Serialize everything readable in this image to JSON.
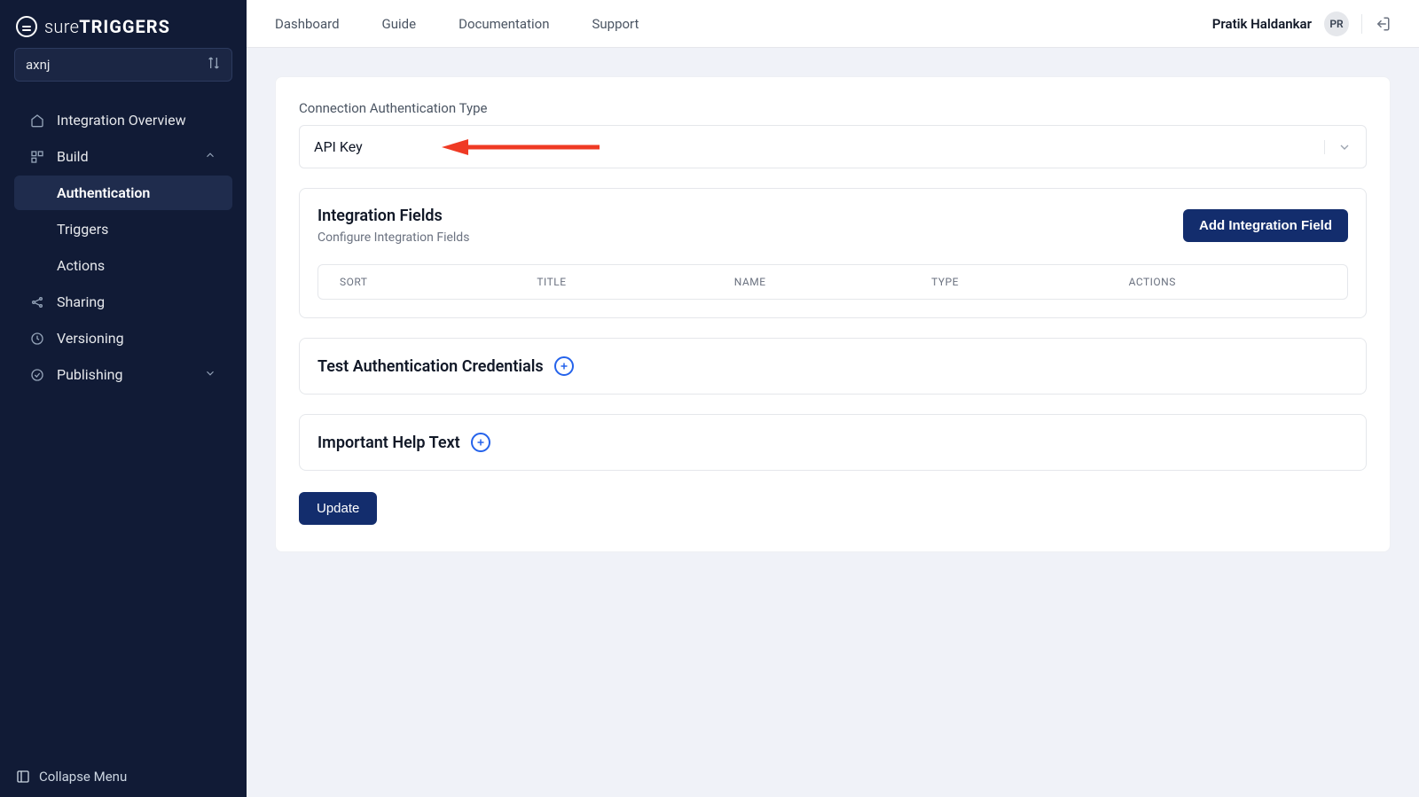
{
  "brand": {
    "name_light": "sure",
    "name_bold": "TRIGGERS"
  },
  "search": {
    "value": "axnj"
  },
  "sidebar": {
    "items": {
      "overview": "Integration Overview",
      "build": "Build",
      "authentication": "Authentication",
      "triggers": "Triggers",
      "actions": "Actions",
      "sharing": "Sharing",
      "versioning": "Versioning",
      "publishing": "Publishing"
    },
    "collapse": "Collapse Menu"
  },
  "topnav": {
    "dashboard": "Dashboard",
    "guide": "Guide",
    "documentation": "Documentation",
    "support": "Support"
  },
  "user": {
    "name": "Pratik Haldankar",
    "initials": "PR"
  },
  "auth": {
    "section_label": "Connection Authentication Type",
    "selected_type": "API Key",
    "integration_fields": {
      "title": "Integration Fields",
      "subtitle": "Configure Integration Fields",
      "add_button": "Add Integration Field",
      "columns": {
        "sort": "SORT",
        "title": "TITLE",
        "name": "NAME",
        "type": "TYPE",
        "actions": "ACTIONS"
      }
    },
    "test_section": "Test Authentication Credentials",
    "help_section": "Important Help Text",
    "update_button": "Update"
  }
}
